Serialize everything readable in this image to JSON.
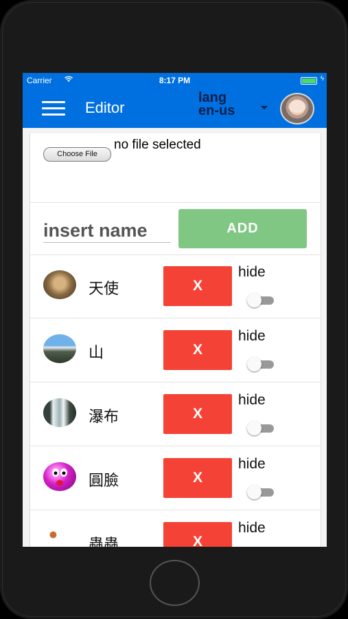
{
  "status_bar": {
    "carrier": "Carrier",
    "time": "8:17 PM"
  },
  "app_bar": {
    "title": "Editor",
    "lang_label": "lang",
    "lang_value": "en-us"
  },
  "file_picker": {
    "button_label": "Choose File",
    "status_text": "no file selected"
  },
  "add_form": {
    "name_placeholder": "insert name",
    "add_label": "ADD"
  },
  "items": [
    {
      "name": "天使",
      "delete_label": "X",
      "hide_label": "hide",
      "hidden": false,
      "avatar": "angel-photo"
    },
    {
      "name": "山",
      "delete_label": "X",
      "hide_label": "hide",
      "hidden": false,
      "avatar": "mountain-photo"
    },
    {
      "name": "瀑布",
      "delete_label": "X",
      "hide_label": "hide",
      "hidden": false,
      "avatar": "waterfall-photo"
    },
    {
      "name": "圓臉",
      "delete_label": "X",
      "hide_label": "hide",
      "hidden": false,
      "avatar": "round-face-icon"
    },
    {
      "name": "蟲蟲",
      "delete_label": "X",
      "hide_label": "hide",
      "hidden": false,
      "avatar": "bug-photo"
    }
  ],
  "colors": {
    "app_bar": "#0070e0",
    "add_button": "#7fc783",
    "delete_button": "#f44336",
    "toggle_track": "#999999"
  }
}
